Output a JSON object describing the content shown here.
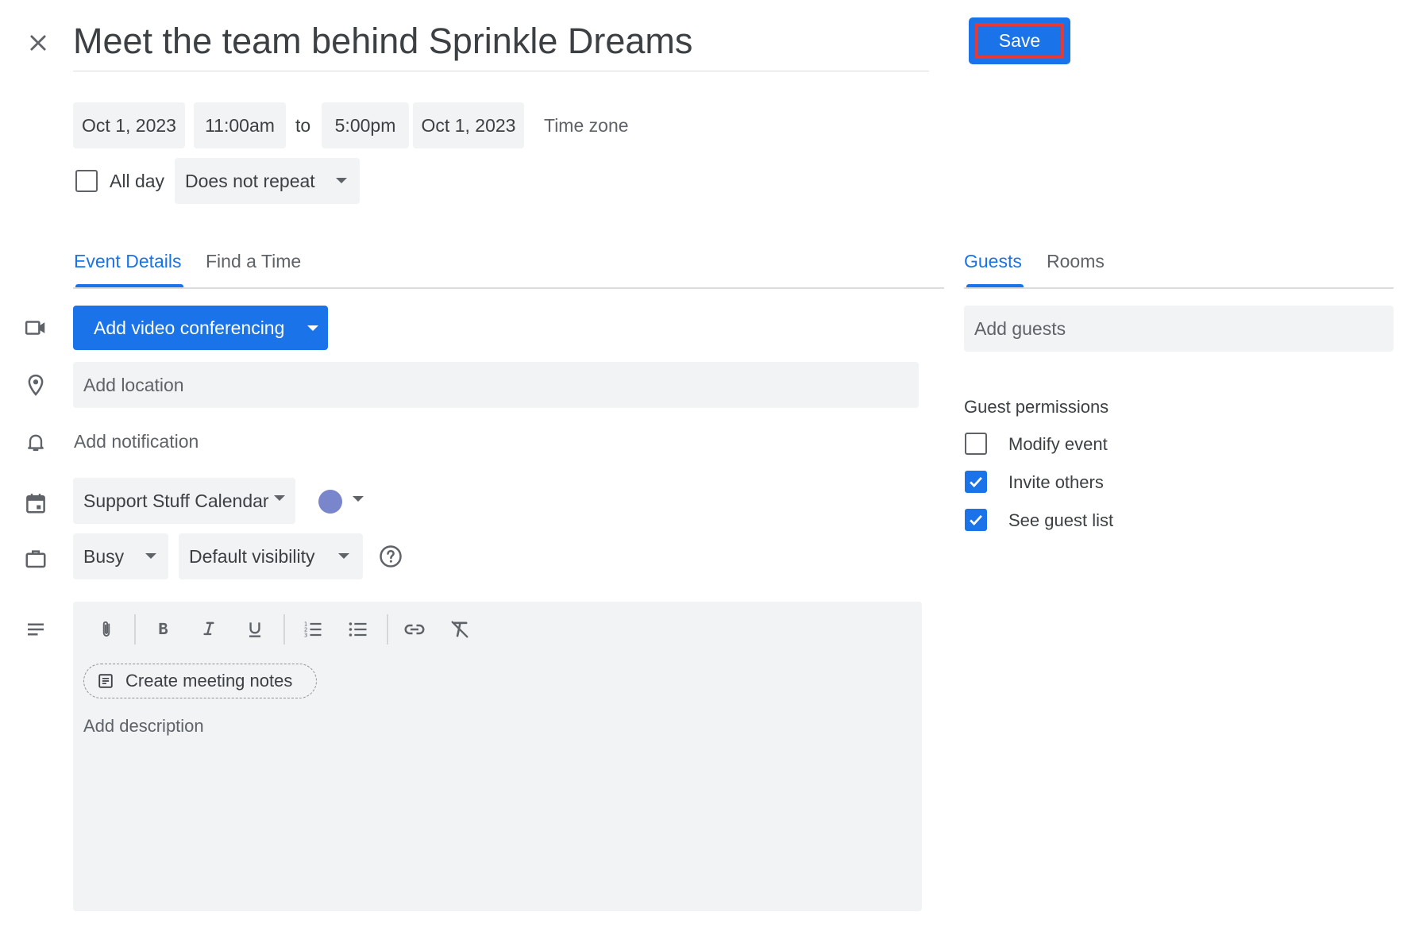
{
  "header": {
    "title": "Meet the team behind Sprinkle Dreams",
    "save_label": "Save"
  },
  "datetime": {
    "start_date": "Oct 1, 2023",
    "start_time": "11:00am",
    "to_label": "to",
    "end_time": "5:00pm",
    "end_date": "Oct 1, 2023",
    "timezone_label": "Time zone",
    "all_day_label": "All day",
    "all_day_checked": false,
    "repeat_value": "Does not repeat"
  },
  "left_tabs": [
    {
      "label": "Event Details",
      "active": true
    },
    {
      "label": "Find a Time",
      "active": false
    }
  ],
  "right_tabs": [
    {
      "label": "Guests",
      "active": true
    },
    {
      "label": "Rooms",
      "active": false
    }
  ],
  "details": {
    "video_button_label": "Add video conferencing",
    "location_placeholder": "Add location",
    "notification_label": "Add notification",
    "calendar_value": "Support Stuff Calendar",
    "calendar_color": "#7986cb",
    "availability_value": "Busy",
    "visibility_value": "Default visibility"
  },
  "editor": {
    "toolbar_icons": [
      "paperclip-icon",
      "bold-icon",
      "italic-icon",
      "underline-icon",
      "numbered-list-icon",
      "bulleted-list-icon",
      "link-icon",
      "clear-formatting-icon"
    ],
    "meeting_notes_label": "Create meeting notes",
    "description_placeholder": "Add description"
  },
  "guests": {
    "add_guests_placeholder": "Add guests",
    "permissions_title": "Guest permissions",
    "permissions": [
      {
        "label": "Modify event",
        "checked": false
      },
      {
        "label": "Invite others",
        "checked": true
      },
      {
        "label": "See guest list",
        "checked": true
      }
    ]
  },
  "colors": {
    "accent": "#1a73e8",
    "field_bg": "#f1f3f4",
    "highlight_border": "#e53935"
  }
}
